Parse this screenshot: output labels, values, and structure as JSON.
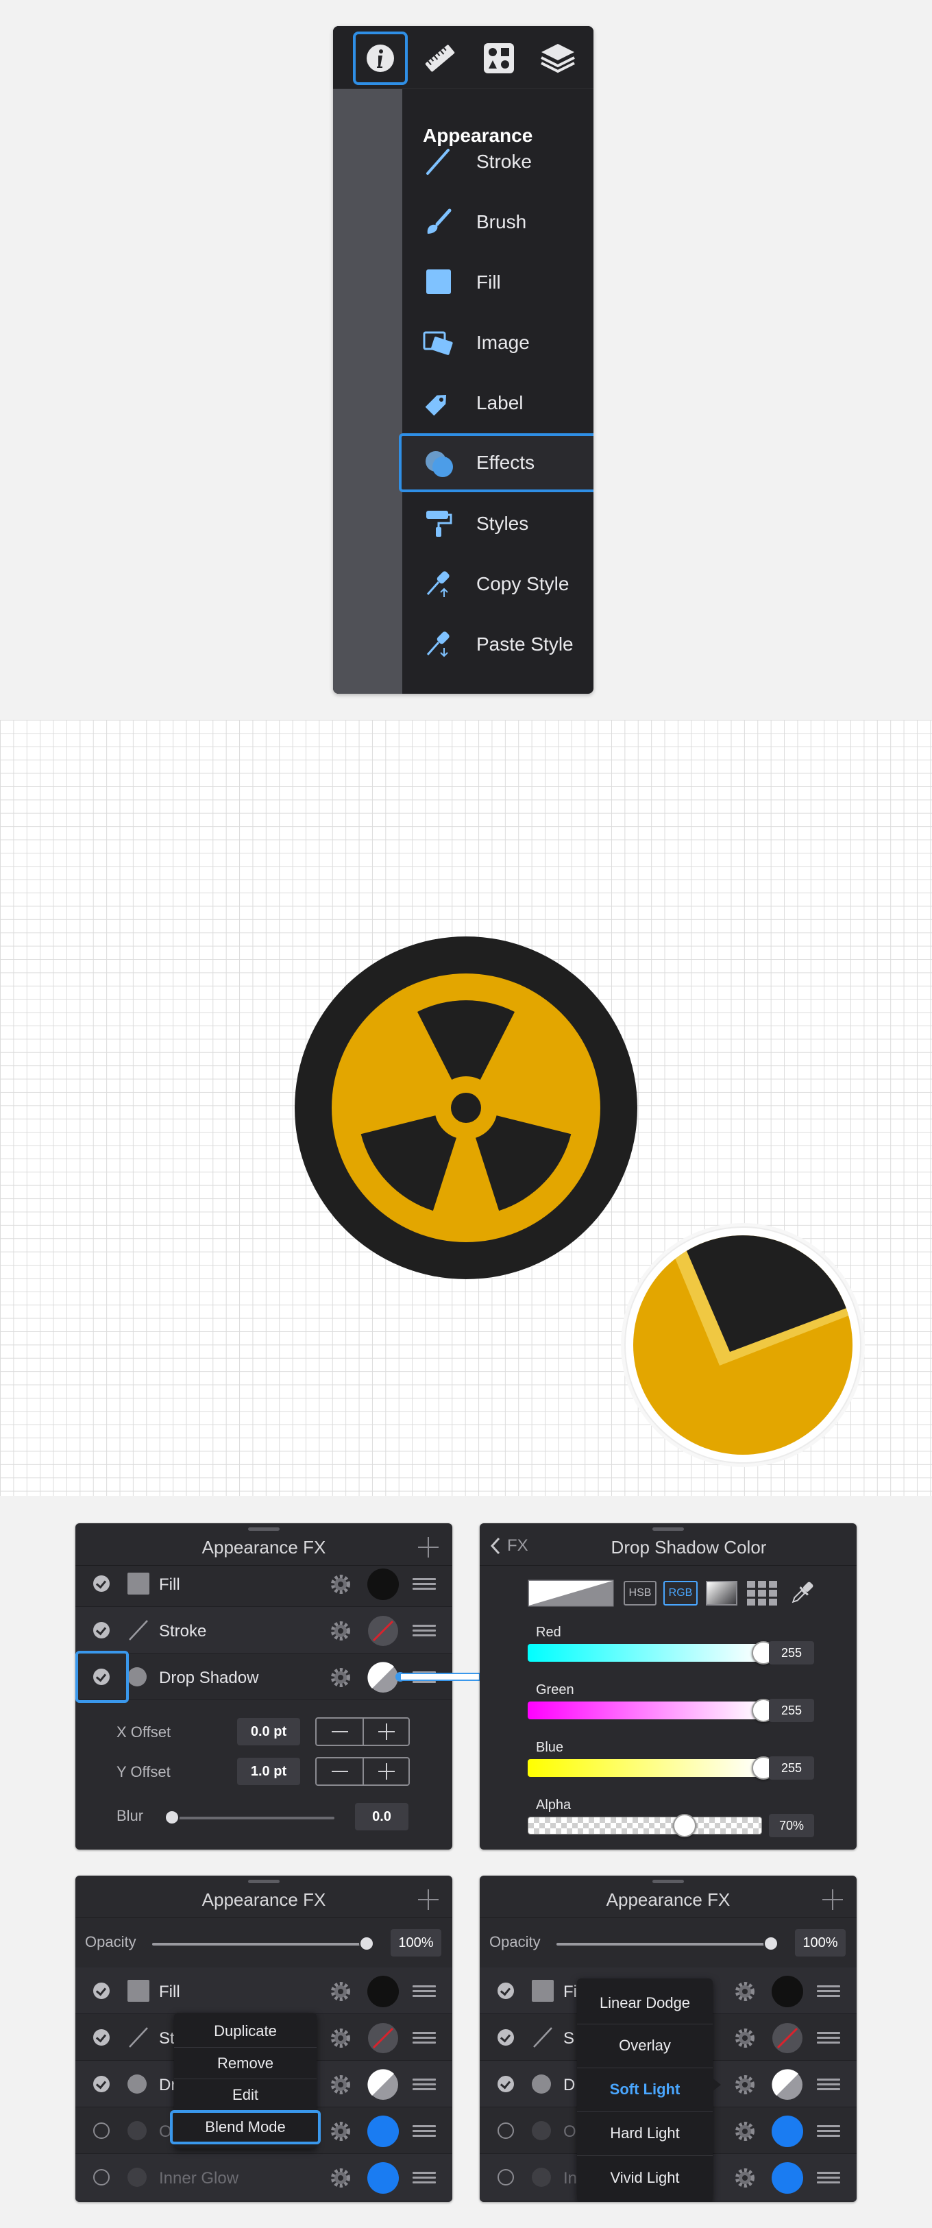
{
  "appearance_menu": {
    "toolbar": [
      {
        "icon": "info-icon"
      },
      {
        "icon": "ruler-icon"
      },
      {
        "icon": "shapes-icon"
      },
      {
        "icon": "layers-icon"
      }
    ],
    "title": "Appearance",
    "items": [
      {
        "label": "Stroke",
        "icon": "stroke-icon"
      },
      {
        "label": "Brush",
        "icon": "brush-icon"
      },
      {
        "label": "Fill",
        "icon": "fill-icon"
      },
      {
        "label": "Image",
        "icon": "image-icon"
      },
      {
        "label": "Label",
        "icon": "label-icon"
      },
      {
        "label": "Effects",
        "icon": "effects-icon",
        "selected": true
      },
      {
        "label": "Styles",
        "icon": "styles-icon"
      },
      {
        "label": "Copy Style",
        "icon": "copy-style-icon"
      },
      {
        "label": "Paste Style",
        "icon": "paste-style-icon"
      }
    ]
  },
  "colors": {
    "accent": "#2f8fe6",
    "panel_bg": "#2a2a2e",
    "radiation_yellow": "#e3a600",
    "radiation_black": "#1f1f1f"
  },
  "fx_panel_1": {
    "title": "Appearance FX",
    "rows": [
      {
        "name": "Fill",
        "kind": "square",
        "enabled": true,
        "swatch": "#111111"
      },
      {
        "name": "Stroke",
        "kind": "line",
        "enabled": true,
        "swatch": "stroke-none"
      },
      {
        "name": "Drop Shadow",
        "kind": "circle",
        "enabled": true,
        "swatch": "white-gray"
      }
    ],
    "x_offset_label": "X Offset",
    "x_offset_value": "0.0 pt",
    "y_offset_label": "Y Offset",
    "y_offset_value": "1.0 pt",
    "blur_label": "Blur",
    "blur_value": "0.0",
    "blur_level": 0
  },
  "color_panel": {
    "back_label": "FX",
    "title": "Drop Shadow Color",
    "modes": [
      "HSB",
      "RGB"
    ],
    "active_mode": "RGB",
    "channels": [
      {
        "label": "Red",
        "value": "255",
        "level": 1.0
      },
      {
        "label": "Green",
        "value": "255",
        "level": 1.0
      },
      {
        "label": "Blue",
        "value": "255",
        "level": 1.0
      },
      {
        "label": "Alpha",
        "value": "70%",
        "level": 0.7
      }
    ]
  },
  "fx_panel_2": {
    "title": "Appearance FX",
    "opacity_label": "Opacity",
    "opacity_value": "100%",
    "rows": [
      {
        "name": "Fill",
        "kind": "square",
        "enabled": true
      },
      {
        "name": "St",
        "kind": "line",
        "enabled": true
      },
      {
        "name": "Dr",
        "kind": "circle",
        "enabled": true
      },
      {
        "name": "O",
        "kind": "circle",
        "enabled": false
      },
      {
        "name": "Inner Glow",
        "kind": "circle",
        "enabled": false
      }
    ],
    "context_menu": [
      "Duplicate",
      "Remove",
      "Edit",
      "Blend Mode"
    ],
    "context_selected": "Blend Mode"
  },
  "fx_panel_3": {
    "title": "Appearance FX",
    "opacity_label": "Opacity",
    "opacity_value": "100%",
    "rows": [
      {
        "name": "Fi",
        "kind": "square",
        "enabled": true
      },
      {
        "name": "S",
        "kind": "line",
        "enabled": true
      },
      {
        "name": "D",
        "kind": "circle",
        "enabled": true
      },
      {
        "name": "O",
        "kind": "circle",
        "enabled": false
      },
      {
        "name": "In",
        "kind": "circle",
        "enabled": false
      }
    ],
    "blend_modes": [
      "Linear Dodge",
      "Overlay",
      "Soft Light",
      "Hard Light",
      "Vivid Light"
    ],
    "blend_selected": "Soft Light"
  }
}
